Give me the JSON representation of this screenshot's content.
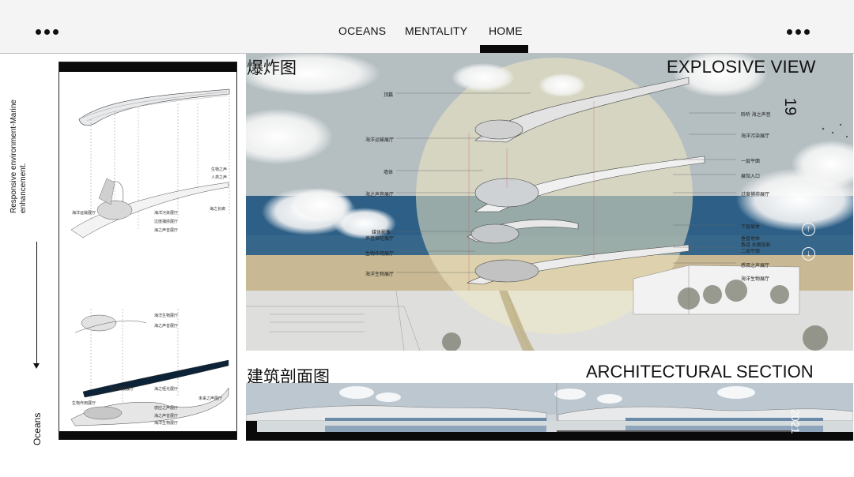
{
  "header": {
    "nav": [
      "OCEANS",
      "MENTALITY",
      "HOME"
    ],
    "active": "HOME"
  },
  "side": {
    "vertical_text": "Responsive environment-Marine enhancement.",
    "bottom_text": "Oceans"
  },
  "left_panel": {
    "labels": [
      "生物之声",
      "人类之声",
      "海洋运输展厅",
      "海洋污染展厅",
      "过度捕捞展厅",
      "海之声音展厅",
      "海之长廊",
      "海洋生物展厅",
      "海之声音展厅",
      "生物作用展厅",
      "在区域展展厅",
      "海之哑光展厅",
      "感应之声展厅",
      "海之声音展厅",
      "未来之声展厅",
      "海洋生物展厅"
    ]
  },
  "explosive": {
    "title_cn": "爆炸图",
    "title_en": "EXPLOSIVE VIEW",
    "page_number": "19",
    "labels_left": [
      "顶篇",
      "海洋运输展厅",
      "墙体",
      "海之声音展厅",
      "媒体影像",
      "声音探吃展厅",
      "生物作用展厅",
      "海洋生物展厅"
    ],
    "labels_right": [
      "聆听 海之声音",
      "海洋污染展厅",
      "一层平面",
      "展馆入口",
      "过度捕捞展厅",
      "下层坡体",
      "垂直地体",
      "散道 水面投影",
      "二层平面",
      "感双之声展厅",
      "海洋生物展厅"
    ]
  },
  "section": {
    "title_cn": "建筑剖面图",
    "title_en": "ARCHITECTURAL SECTION",
    "year": "2021"
  },
  "colors": {
    "sea": "#2e5f86",
    "sand": "#c8b893",
    "sky": "#b9c2c4",
    "ink": "#0a0a0a"
  },
  "icons": [
    "arrow-up-icon",
    "arrow-down-icon",
    "menu-dots-icon"
  ]
}
